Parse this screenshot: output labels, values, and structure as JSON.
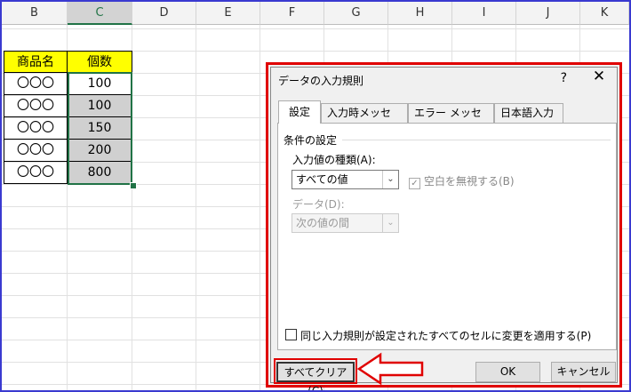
{
  "columns": [
    "B",
    "C",
    "D",
    "E",
    "F",
    "G",
    "H",
    "I",
    "J",
    "K"
  ],
  "table": {
    "header_name": "商品名",
    "header_count": "個数",
    "rows": [
      {
        "name": "〇〇〇",
        "count": "100"
      },
      {
        "name": "〇〇〇",
        "count": "100"
      },
      {
        "name": "〇〇〇",
        "count": "150"
      },
      {
        "name": "〇〇〇",
        "count": "200"
      },
      {
        "name": "〇〇〇",
        "count": "800"
      }
    ]
  },
  "dialog": {
    "title": "データの入力規則",
    "help": "?",
    "close": "✕",
    "tabs": [
      "設定",
      "入力時メッセージ",
      "エラー メッセージ",
      "日本語入力"
    ],
    "group_title": "条件の設定",
    "allow_label": "入力値の種類(A):",
    "allow_value": "すべての値",
    "ignore_blank": "空白を無視する(B)",
    "data_label": "データ(D):",
    "data_value": "次の値の間",
    "apply_all": "同じ入力規則が設定されたすべてのセルに変更を適用する(P)",
    "clear_button": "すべてクリア(C)",
    "ok_button": "OK",
    "cancel_button": "キャンセル"
  },
  "colors": {
    "header_fill": "#ffff00",
    "highlight": "#e00000",
    "selection": "#217346"
  }
}
